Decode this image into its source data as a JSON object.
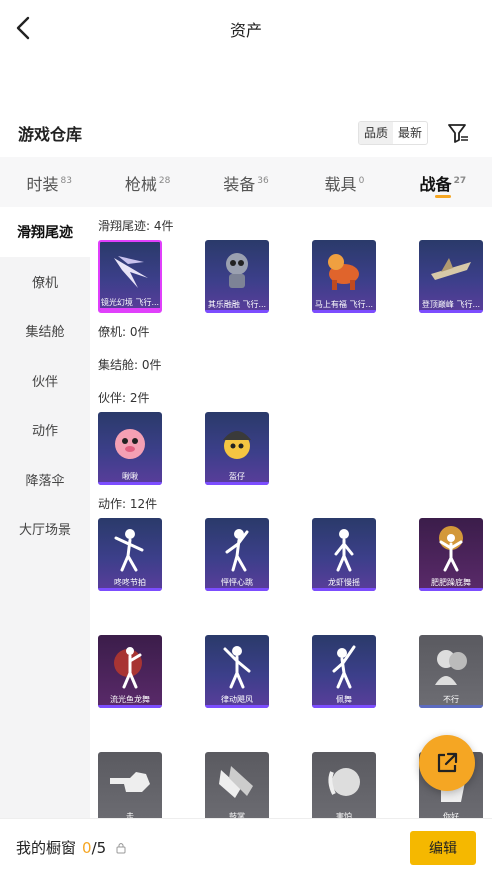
{
  "header": {
    "title": "资产"
  },
  "warehouse": {
    "title": "游戏仓库",
    "sort_quality": "品质",
    "sort_newest": "最新"
  },
  "tabs": [
    {
      "label": "时装",
      "count": "83"
    },
    {
      "label": "枪械",
      "count": "28"
    },
    {
      "label": "装备",
      "count": "36"
    },
    {
      "label": "载具",
      "count": "0"
    },
    {
      "label": "战备",
      "count": "27"
    }
  ],
  "sidebar": [
    {
      "label": "滑翔尾迹"
    },
    {
      "label": "僚机"
    },
    {
      "label": "集结舱"
    },
    {
      "label": "伙伴"
    },
    {
      "label": "动作"
    },
    {
      "label": "降落伞"
    },
    {
      "label": "大厅场景"
    }
  ],
  "sections": {
    "trail": {
      "label": "滑翔尾迹: 4件",
      "items": [
        "镜光幻境 飞行...",
        "其乐融融 飞行...",
        "马上有福 飞行...",
        "登顶巅峰 飞行..."
      ]
    },
    "wingman": {
      "label": "僚机: 0件"
    },
    "pod": {
      "label": "集结舱: 0件"
    },
    "partner": {
      "label": "伙伴: 2件",
      "items": [
        "啾啾",
        "盔仔"
      ]
    },
    "emote": {
      "label": "动作: 12件",
      "items": [
        "咚咚节拍",
        "怦怦心跳",
        "龙虾慢摇",
        "肥肥躁底舞",
        "流光鱼龙舞",
        "律动飓风",
        "佩舞",
        "不行",
        "走",
        "鼓掌",
        "害怕",
        "你好"
      ]
    }
  },
  "bottom": {
    "label": "我的橱窗",
    "current": "0",
    "total": "/5",
    "edit_label": "编辑"
  },
  "colors": {
    "accent": "#f5a623",
    "edit_button": "#f5b800",
    "card_purple": "#3c3f8a"
  }
}
